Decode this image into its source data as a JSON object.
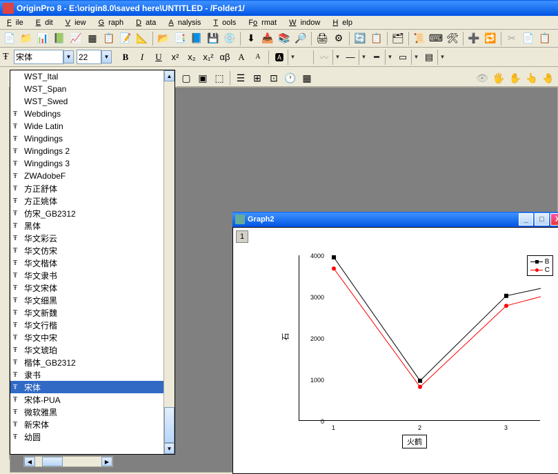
{
  "app": {
    "title": "OriginPro 8 - E:\\origin8.0\\saved here\\UNTITLED - /Folder1/"
  },
  "menu": {
    "file": "File",
    "edit": "Edit",
    "view": "View",
    "graph": "Graph",
    "data": "Data",
    "analysis": "Analysis",
    "tools": "Tools",
    "format": "Format",
    "window": "Window",
    "help": "Help"
  },
  "format_bar": {
    "font_name": "宋体",
    "font_size": "22"
  },
  "font_list": [
    "WST_Ital",
    "WST_Span",
    "WST_Swed",
    "Webdings",
    "Wide Latin",
    "Wingdings",
    "Wingdings 2",
    "Wingdings 3",
    "ZWAdobeF",
    "方正舒体",
    "方正姚体",
    "仿宋_GB2312",
    "黑体",
    "华文彩云",
    "华文仿宋",
    "华文楷体",
    "华文隶书",
    "华文宋体",
    "华文细黑",
    "华文新魏",
    "华文行楷",
    "华文中宋",
    "华文琥珀",
    "楷体_GB2312",
    "隶书",
    "宋体",
    "宋体-PUA",
    "微软雅黑",
    "新宋体",
    "幼圆"
  ],
  "font_selected_index": 25,
  "font_no_tt_indices": [
    0,
    1,
    2
  ],
  "graph_window": {
    "title": "Graph2",
    "layer": "1"
  },
  "chart_data": {
    "type": "line",
    "x": [
      1,
      2,
      3
    ],
    "series": [
      {
        "name": "B",
        "values": [
          3950,
          970,
          3020
        ],
        "color": "#000000",
        "marker": "square"
      },
      {
        "name": "C",
        "values": [
          3680,
          820,
          2780
        ],
        "color": "#ff0000",
        "marker": "circle"
      }
    ],
    "xlabel": "火鹤",
    "ylabel": "石",
    "ylim": [
      0,
      4000
    ],
    "yticks": [
      0,
      1000,
      2000,
      3000,
      4000
    ],
    "xticks": [
      1,
      2,
      3
    ]
  }
}
